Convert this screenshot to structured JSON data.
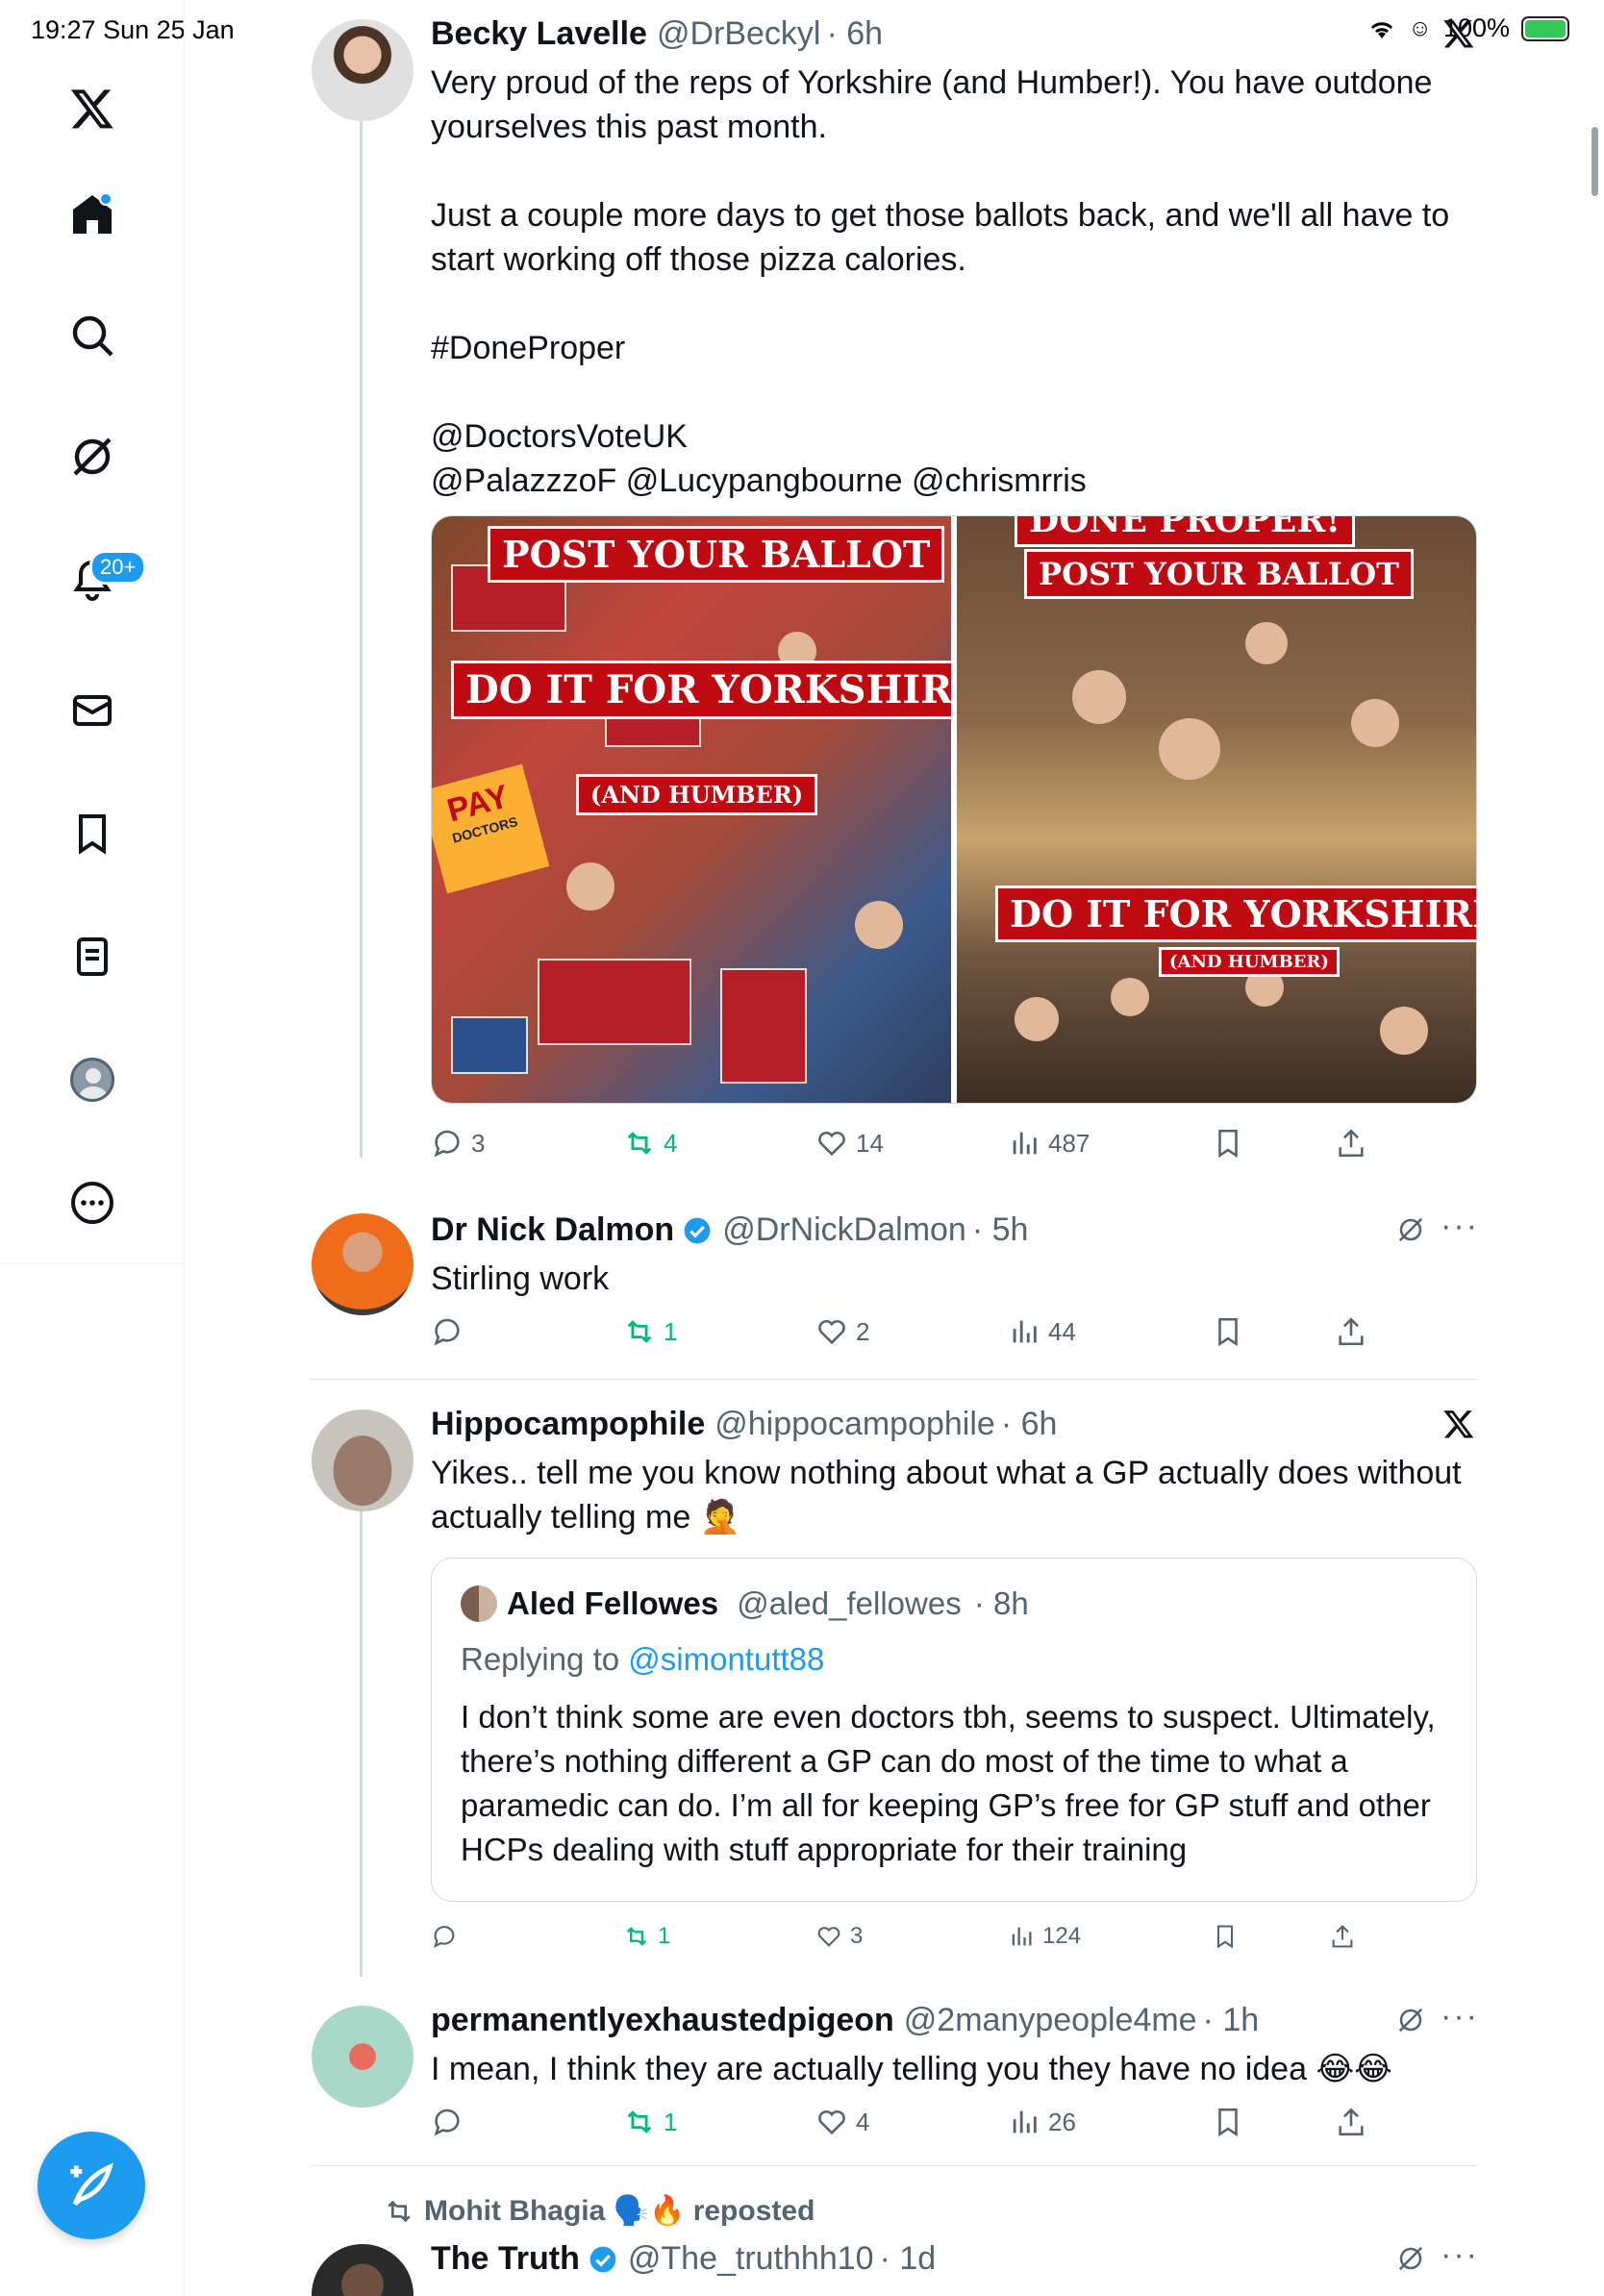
{
  "status": {
    "time": "19:27",
    "date": "Sun 25 Jan",
    "battery": "100%"
  },
  "sidebar": {
    "notifications_badge": "20+"
  },
  "posts": [
    {
      "name": "Becky Lavelle",
      "handle": "@DrBeckyl",
      "time": "· 6h",
      "text": "Very proud of the reps of Yorkshire (and Humber!). You have outdone yourselves this past month.\n\nJust a couple more days to get those ballots back, and we'll all have to start working off those pizza calories.\n\n#DoneProper\n\n@DoctorsVoteUK\n@PalazzzoF @Lucypangbourne @chrismrris",
      "media": {
        "left_banner_1": "POST YOUR BALLOT",
        "left_banner_2": "DO IT FOR YORKSHIRE",
        "left_banner_3": "(AND HUMBER)",
        "pay_badge": "PAY",
        "pay_sub": "DOCTORS",
        "right_banner_top": "DONE PROPER!",
        "right_banner_1": "POST YOUR BALLOT",
        "right_banner_2": "DO IT FOR YORKSHIRE",
        "right_banner_3": "(AND HUMBER)"
      },
      "replies": "3",
      "reposts": "4",
      "likes": "14",
      "views": "487"
    },
    {
      "name": "Dr Nick Dalmon",
      "handle": "@DrNickDalmon",
      "time": "· 5h",
      "text": "Stirling work",
      "replies": "",
      "reposts": "1",
      "likes": "2",
      "views": "44"
    },
    {
      "name": "Hippocampophile",
      "handle": "@hippocampophile",
      "time": "· 6h",
      "text": "Yikes.. tell me you know nothing about what a GP actually does without actually telling me 🤦",
      "quote": {
        "name": "Aled Fellowes",
        "handle": "@aled_fellowes",
        "time": "· 8h",
        "replying_label": "Replying to",
        "replying_to": "@simontutt88",
        "text": "I don’t think some are even doctors tbh, seems to suspect. Ultimately, there’s nothing different a GP can do most of the time to what a paramedic can do. I’m all for keeping GP’s free for GP stuff and other HCPs dealing with stuff appropriate for their training"
      },
      "replies": "",
      "reposts": "1",
      "likes": "3",
      "views": "124"
    },
    {
      "name": "permanentlyexhaustedpigeon",
      "handle": "@2manypeople4me",
      "time": "· 1h",
      "text": "I mean, I think they are actually telling you they have no idea 😂😂",
      "replies": "",
      "reposts": "1",
      "likes": "4",
      "views": "26"
    },
    {
      "repost_by": "Mohit Bhagia 🗣️🔥 reposted",
      "name": "The Truth",
      "handle": "@The_truthhh10",
      "time": "· 1d"
    }
  ],
  "colors": {
    "accent": "#1d9bf0",
    "repost_green": "#00ba7c",
    "muted": "#536471"
  }
}
